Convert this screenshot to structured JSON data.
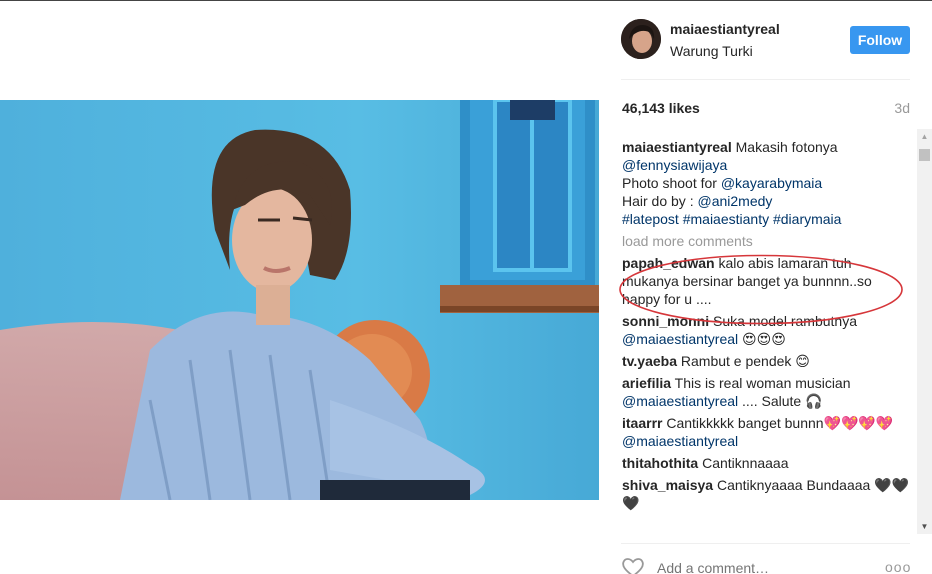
{
  "post": {
    "username": "maiaestiantyreal",
    "location": "Warung Turki",
    "follow_label": "Follow",
    "likes": "46,143 likes",
    "time": "3d",
    "caption": {
      "user": "maiaestiantyreal",
      "t1": "Makasih fotonya",
      "m1": "@fennysiawijaya",
      "t2": "Photo shoot for",
      "m2": "@kayarabymaia",
      "t3": "Hair do by :",
      "m3": "@ani2medy",
      "tags": "#latepost #maiaestianty #diarymaia"
    },
    "load_more": "load more comments",
    "add_comment_placeholder": "Add a comment…",
    "more_label": "ooo"
  },
  "comments": [
    {
      "user": "papah_edwan",
      "text": "kalo abis lamaran tuh mukanya bersinar banget ya bunnnn..so happy for u ...."
    },
    {
      "user": "sonni_monni",
      "text": "Suka model rambutnya",
      "mention": "@maiaestiantyreal",
      "after": "😍😍😍"
    },
    {
      "user": "tv.yaeba",
      "text": "Rambut e pendek 😊"
    },
    {
      "user": "ariefilia",
      "text": "This is real woman musician",
      "mention": "@maiaestiantyreal",
      "after": ".... Salute 🎧"
    },
    {
      "user": "itaarrr",
      "text": "Cantikkkkk banget bunnn💖💖💖💖",
      "mention": "@maiaestiantyreal"
    },
    {
      "user": "thitahothita",
      "text": "Cantiknnaaaa"
    },
    {
      "user": "shiva_maisya",
      "text": "Cantiknyaaaa Bundaaaa 🖤🖤🖤"
    }
  ],
  "colors": {
    "accent": "#3897f0",
    "mention": "#003569",
    "annotation": "#d6363a"
  },
  "icons": {
    "like": "heart-icon",
    "more": "more-options-icon"
  }
}
